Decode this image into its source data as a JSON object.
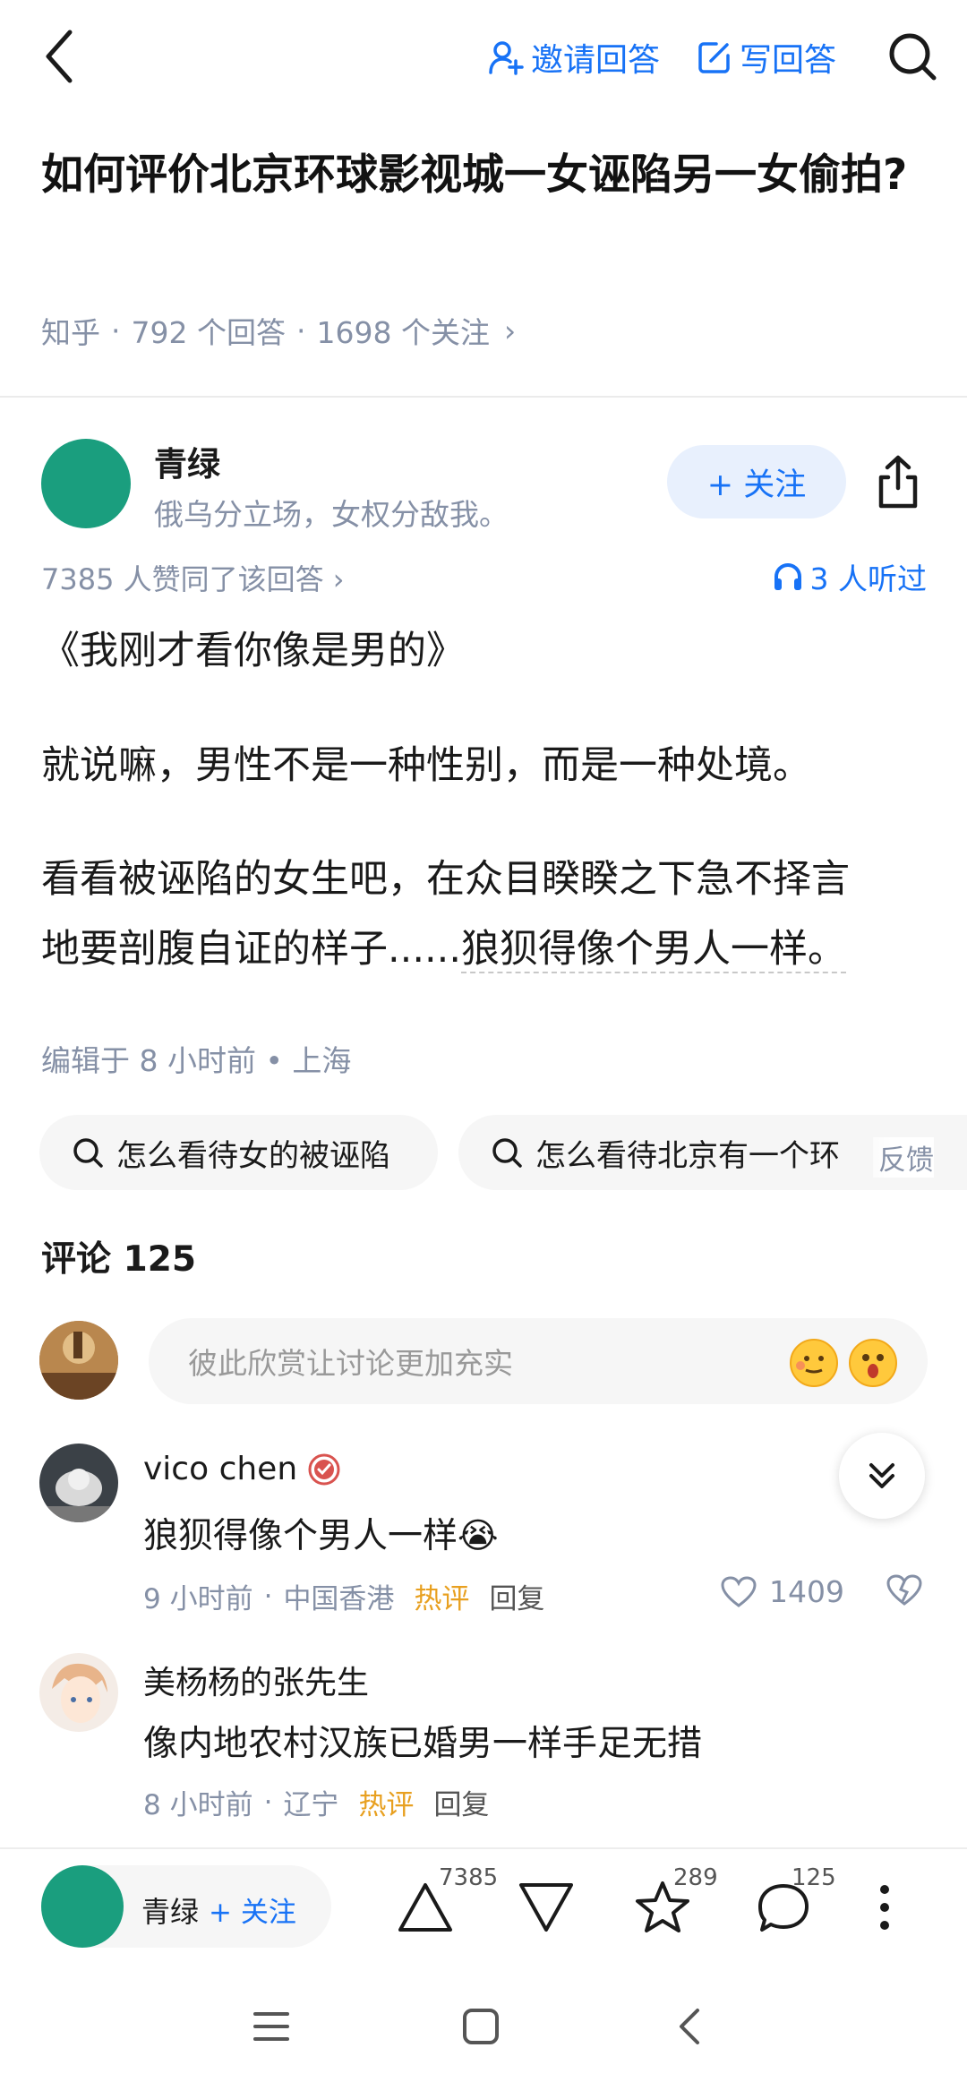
{
  "header": {
    "invite_label": "邀请回答",
    "write_label": "写回答"
  },
  "question": {
    "title": "如何评价北京环球影视城一女诬陷另一女偷拍?",
    "source": "知乎",
    "answers": "792 个回答",
    "follows": "1698 个关注",
    "chevron": "›"
  },
  "author": {
    "name": "青绿",
    "bio": "俄乌分立场，女权分敌我。",
    "follow_label": "+ 关注",
    "avatar_color": "#1a9e7e"
  },
  "answer": {
    "likes_text": "7385 人赞同了该回答 ›",
    "listen_text": "3 人听过",
    "para1": "《我刚才看你像是男的》",
    "para2": "就说嘛，男性不是一种性别，而是一种处境。",
    "para3_line1": "看看被诬陷的女生吧，在众目睽睽之下急不择言",
    "para3_line2_a": "地要剖腹自证的样子......",
    "para3_line2_b": "狼狈得像个男人一样。",
    "edited": "编辑于 8 小时前 • 上海"
  },
  "related": {
    "chip1": "怎么看待女的被诬陷",
    "chip2": "怎么看待北京有一个环",
    "feedback": "反馈"
  },
  "comments": {
    "title": "评论 125",
    "input_placeholder": "彼此欣赏让讨论更加充实",
    "items": [
      {
        "name": "vico chen",
        "text": "狼狈得像个男人一样😭",
        "time": "9 小时前",
        "location": "中国香港",
        "hot": "热评",
        "reply": "回复",
        "likes": "1409"
      },
      {
        "name": "美杨杨的张先生",
        "text": "像内地农村汉族已婚男一样手足无措",
        "time": "8 小时前",
        "location": "辽宁",
        "hot": "热评",
        "reply": "回复"
      }
    ]
  },
  "bottom_bar": {
    "author_name": "青绿",
    "follow_label": "+ 关注",
    "upvotes": "7385",
    "favorites": "289",
    "comments": "125"
  },
  "colors": {
    "accent": "#1772f6",
    "hot": "#e8a020",
    "muted": "#8590a6"
  }
}
